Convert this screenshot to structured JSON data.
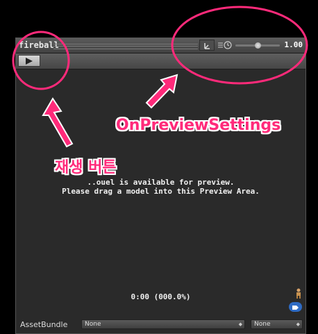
{
  "window": {
    "title": "fireball",
    "speed_value": "1.00"
  },
  "preview": {
    "message_line1": "..ouel is available for preview.",
    "message_line2": "Please drag a model into this Preview Area.",
    "time_readout": "0:00 (000.0%)"
  },
  "bottom_bar": {
    "label": "AssetBundle",
    "dropdown1_value": "None",
    "dropdown2_value": "None"
  },
  "annotations": {
    "settings_label": "OnPreviewSettings",
    "play_button_label": "재생 버튼",
    "color": "#ff2a7a"
  },
  "icons": [
    "settings-gizmo-icon",
    "playback-speed-icon",
    "avatar-icon",
    "asset-label-tag-icon",
    "play-icon"
  ]
}
